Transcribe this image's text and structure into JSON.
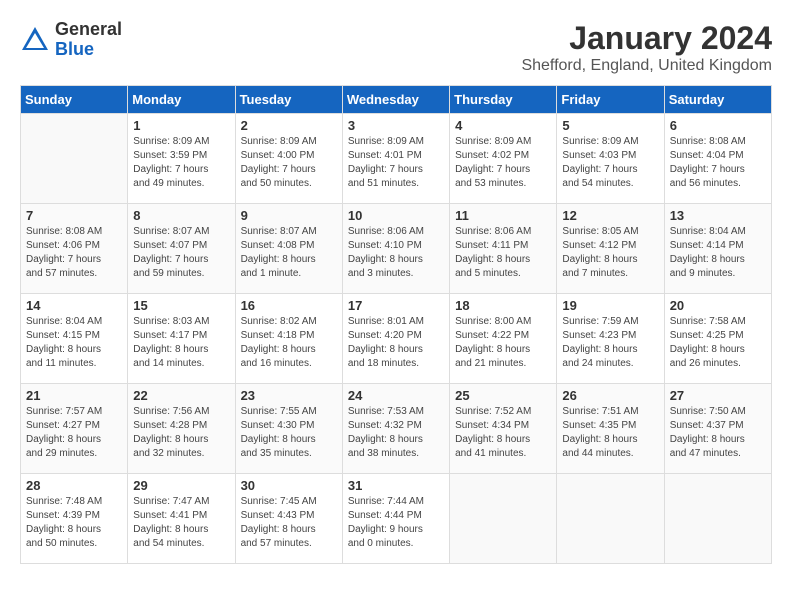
{
  "logo": {
    "general": "General",
    "blue": "Blue"
  },
  "title": {
    "month": "January 2024",
    "location": "Shefford, England, United Kingdom"
  },
  "headers": [
    "Sunday",
    "Monday",
    "Tuesday",
    "Wednesday",
    "Thursday",
    "Friday",
    "Saturday"
  ],
  "weeks": [
    [
      {
        "day": "",
        "details": ""
      },
      {
        "day": "1",
        "details": "Sunrise: 8:09 AM\nSunset: 3:59 PM\nDaylight: 7 hours\nand 49 minutes."
      },
      {
        "day": "2",
        "details": "Sunrise: 8:09 AM\nSunset: 4:00 PM\nDaylight: 7 hours\nand 50 minutes."
      },
      {
        "day": "3",
        "details": "Sunrise: 8:09 AM\nSunset: 4:01 PM\nDaylight: 7 hours\nand 51 minutes."
      },
      {
        "day": "4",
        "details": "Sunrise: 8:09 AM\nSunset: 4:02 PM\nDaylight: 7 hours\nand 53 minutes."
      },
      {
        "day": "5",
        "details": "Sunrise: 8:09 AM\nSunset: 4:03 PM\nDaylight: 7 hours\nand 54 minutes."
      },
      {
        "day": "6",
        "details": "Sunrise: 8:08 AM\nSunset: 4:04 PM\nDaylight: 7 hours\nand 56 minutes."
      }
    ],
    [
      {
        "day": "7",
        "details": "Sunrise: 8:08 AM\nSunset: 4:06 PM\nDaylight: 7 hours\nand 57 minutes."
      },
      {
        "day": "8",
        "details": "Sunrise: 8:07 AM\nSunset: 4:07 PM\nDaylight: 7 hours\nand 59 minutes."
      },
      {
        "day": "9",
        "details": "Sunrise: 8:07 AM\nSunset: 4:08 PM\nDaylight: 8 hours\nand 1 minute."
      },
      {
        "day": "10",
        "details": "Sunrise: 8:06 AM\nSunset: 4:10 PM\nDaylight: 8 hours\nand 3 minutes."
      },
      {
        "day": "11",
        "details": "Sunrise: 8:06 AM\nSunset: 4:11 PM\nDaylight: 8 hours\nand 5 minutes."
      },
      {
        "day": "12",
        "details": "Sunrise: 8:05 AM\nSunset: 4:12 PM\nDaylight: 8 hours\nand 7 minutes."
      },
      {
        "day": "13",
        "details": "Sunrise: 8:04 AM\nSunset: 4:14 PM\nDaylight: 8 hours\nand 9 minutes."
      }
    ],
    [
      {
        "day": "14",
        "details": "Sunrise: 8:04 AM\nSunset: 4:15 PM\nDaylight: 8 hours\nand 11 minutes."
      },
      {
        "day": "15",
        "details": "Sunrise: 8:03 AM\nSunset: 4:17 PM\nDaylight: 8 hours\nand 14 minutes."
      },
      {
        "day": "16",
        "details": "Sunrise: 8:02 AM\nSunset: 4:18 PM\nDaylight: 8 hours\nand 16 minutes."
      },
      {
        "day": "17",
        "details": "Sunrise: 8:01 AM\nSunset: 4:20 PM\nDaylight: 8 hours\nand 18 minutes."
      },
      {
        "day": "18",
        "details": "Sunrise: 8:00 AM\nSunset: 4:22 PM\nDaylight: 8 hours\nand 21 minutes."
      },
      {
        "day": "19",
        "details": "Sunrise: 7:59 AM\nSunset: 4:23 PM\nDaylight: 8 hours\nand 24 minutes."
      },
      {
        "day": "20",
        "details": "Sunrise: 7:58 AM\nSunset: 4:25 PM\nDaylight: 8 hours\nand 26 minutes."
      }
    ],
    [
      {
        "day": "21",
        "details": "Sunrise: 7:57 AM\nSunset: 4:27 PM\nDaylight: 8 hours\nand 29 minutes."
      },
      {
        "day": "22",
        "details": "Sunrise: 7:56 AM\nSunset: 4:28 PM\nDaylight: 8 hours\nand 32 minutes."
      },
      {
        "day": "23",
        "details": "Sunrise: 7:55 AM\nSunset: 4:30 PM\nDaylight: 8 hours\nand 35 minutes."
      },
      {
        "day": "24",
        "details": "Sunrise: 7:53 AM\nSunset: 4:32 PM\nDaylight: 8 hours\nand 38 minutes."
      },
      {
        "day": "25",
        "details": "Sunrise: 7:52 AM\nSunset: 4:34 PM\nDaylight: 8 hours\nand 41 minutes."
      },
      {
        "day": "26",
        "details": "Sunrise: 7:51 AM\nSunset: 4:35 PM\nDaylight: 8 hours\nand 44 minutes."
      },
      {
        "day": "27",
        "details": "Sunrise: 7:50 AM\nSunset: 4:37 PM\nDaylight: 8 hours\nand 47 minutes."
      }
    ],
    [
      {
        "day": "28",
        "details": "Sunrise: 7:48 AM\nSunset: 4:39 PM\nDaylight: 8 hours\nand 50 minutes."
      },
      {
        "day": "29",
        "details": "Sunrise: 7:47 AM\nSunset: 4:41 PM\nDaylight: 8 hours\nand 54 minutes."
      },
      {
        "day": "30",
        "details": "Sunrise: 7:45 AM\nSunset: 4:43 PM\nDaylight: 8 hours\nand 57 minutes."
      },
      {
        "day": "31",
        "details": "Sunrise: 7:44 AM\nSunset: 4:44 PM\nDaylight: 9 hours\nand 0 minutes."
      },
      {
        "day": "",
        "details": ""
      },
      {
        "day": "",
        "details": ""
      },
      {
        "day": "",
        "details": ""
      }
    ]
  ]
}
